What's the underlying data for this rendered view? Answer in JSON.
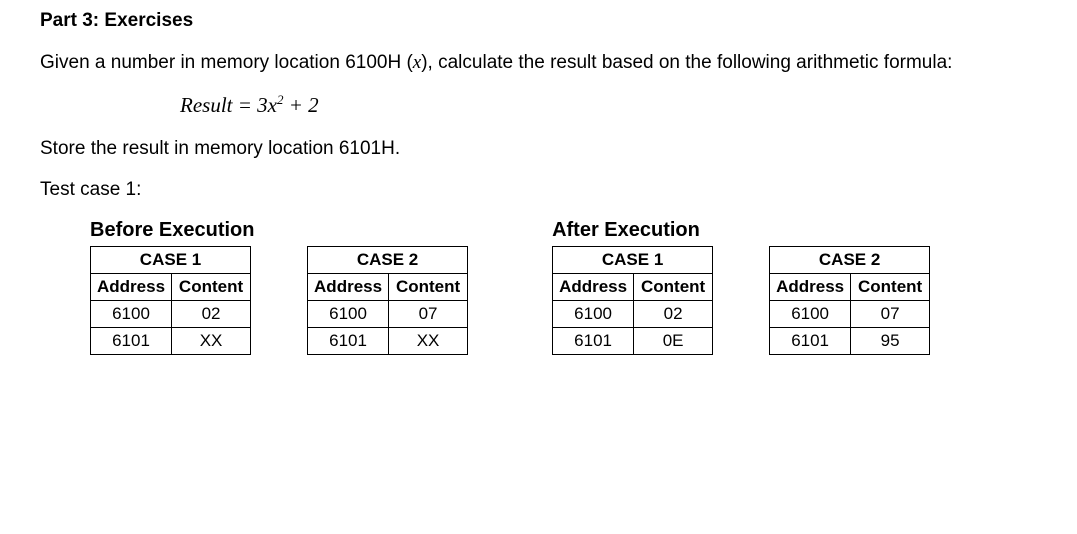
{
  "heading": "Part 3: Exercises",
  "intro_a": "Given a number in memory location 6100H (",
  "intro_x": "x",
  "intro_b": "), calculate the result based on the following arithmetic formula:",
  "formula": {
    "lhs": "Result",
    "eq": " = ",
    "c1": "3",
    "var": "x",
    "exp": "2",
    "plus": " + ",
    "c2": "2"
  },
  "store_line": "Store the result in memory location 6101H.",
  "testcase_label": "Test case 1:",
  "before_title": "Before Execution",
  "after_title": "After Execution",
  "col_addr": "Address",
  "col_cont": "Content",
  "before": [
    {
      "case": "CASE 1",
      "rows": [
        {
          "addr": "6100",
          "val": "02"
        },
        {
          "addr": "6101",
          "val": "XX"
        }
      ]
    },
    {
      "case": "CASE 2",
      "rows": [
        {
          "addr": "6100",
          "val": "07"
        },
        {
          "addr": "6101",
          "val": "XX"
        }
      ]
    }
  ],
  "after": [
    {
      "case": "CASE 1",
      "rows": [
        {
          "addr": "6100",
          "val": "02"
        },
        {
          "addr": "6101",
          "val": "0E"
        }
      ]
    },
    {
      "case": "CASE 2",
      "rows": [
        {
          "addr": "6100",
          "val": "07"
        },
        {
          "addr": "6101",
          "val": "95"
        }
      ]
    }
  ]
}
